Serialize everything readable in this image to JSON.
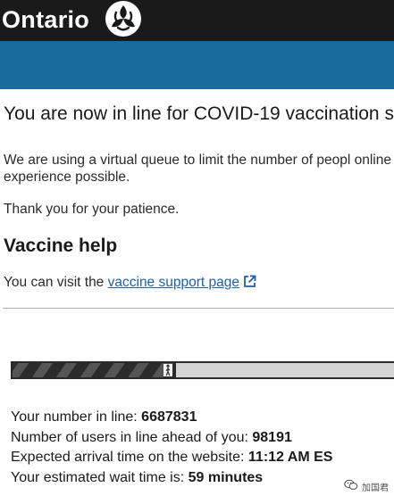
{
  "header": {
    "brand": "Ontario",
    "logo_icon": "trillium-logo-icon"
  },
  "colors": {
    "header_bg": "#1a1a1a",
    "band_bg": "#1a6b9d",
    "link": "#1f5fa8"
  },
  "main": {
    "title": "You are now in line for COVID-19 vaccination s",
    "intro": "We are using a virtual queue to limit the number of peopl online experience possible.",
    "thanks": "Thank you for your patience.",
    "help_heading": "Vaccine help",
    "help_prefix": "You can visit the ",
    "help_link": "vaccine support page",
    "help_link_icon": "external-link-icon"
  },
  "queue": {
    "progress_fraction": 0.42,
    "progress_icon": "walking-person-icon",
    "number_label": "Your number in line: ",
    "number_value": "6687831",
    "ahead_label": "Number of users in line ahead of you: ",
    "ahead_value": "98191",
    "arrival_label": "Expected arrival time on the website: ",
    "arrival_value": "11:12 AM ES",
    "wait_label": "Your estimated wait time is: ",
    "wait_value": "59 minutes"
  },
  "watermark": {
    "text": "加国君",
    "icon": "wechat-account-icon"
  }
}
